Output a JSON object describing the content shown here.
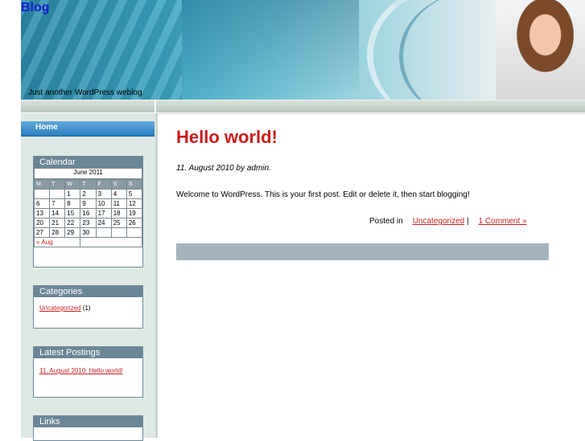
{
  "header": {
    "blog_title": "Blog",
    "tagline": "Just another WordPress weblog"
  },
  "nav": {
    "home": "Home"
  },
  "calendar": {
    "title": "Calendar",
    "month": "June 2011",
    "weekdays": [
      "M",
      "T",
      "W",
      "T",
      "F",
      "S",
      "S"
    ],
    "weeks": [
      [
        "",
        "",
        "1",
        "2",
        "3",
        "4",
        "5"
      ],
      [
        "6",
        "7",
        "8",
        "9",
        "10",
        "11",
        "12"
      ],
      [
        "13",
        "14",
        "15",
        "16",
        "17",
        "18",
        "19"
      ],
      [
        "20",
        "21",
        "22",
        "23",
        "24",
        "25",
        "26"
      ],
      [
        "27",
        "28",
        "29",
        "30",
        "",
        "",
        ""
      ]
    ],
    "prev_link": "« Aug"
  },
  "categories": {
    "title": "Categories",
    "items": [
      {
        "label": "Uncategorized",
        "count": " (1)"
      }
    ]
  },
  "latest": {
    "title": "Latest Postings",
    "items": [
      {
        "label": "11. August 2010: Hello world!"
      }
    ]
  },
  "links": {
    "title": "Links"
  },
  "post": {
    "title": "Hello world!",
    "meta": "11. August 2010 by admin.",
    "body": "Welcome to WordPress. This is your first post. Edit or delete it, then start blogging!",
    "posted_in": "Posted in",
    "category": "Uncategorized",
    "separator": "|",
    "comments": "1 Comment »"
  }
}
